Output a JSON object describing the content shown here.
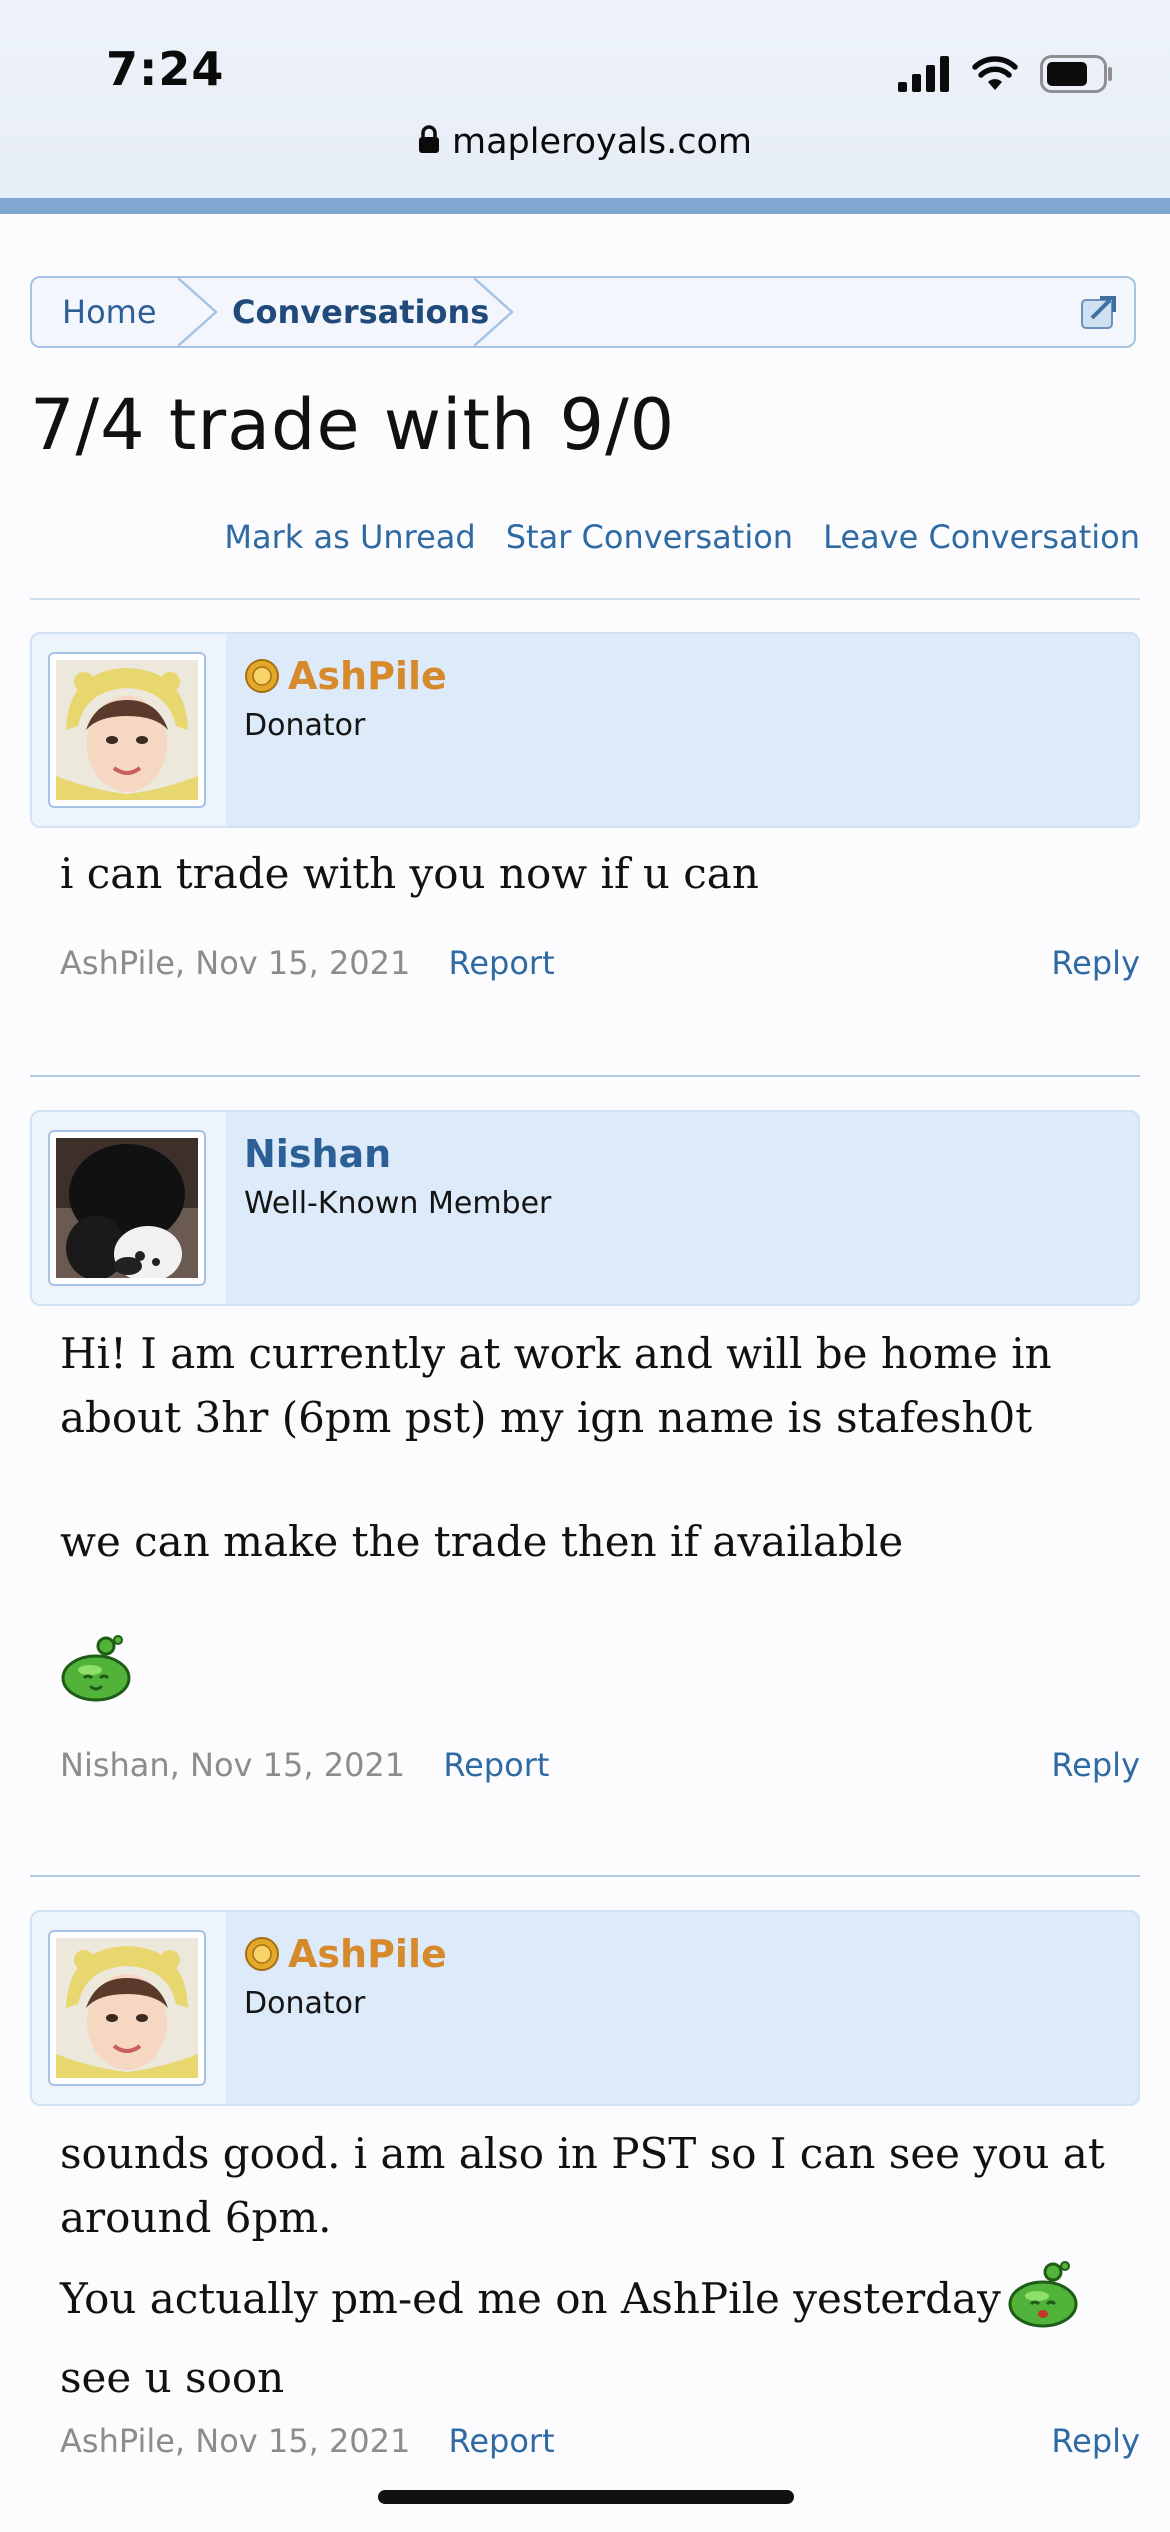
{
  "status_bar": {
    "time": "7:24"
  },
  "browser": {
    "url": "mapleroyals.com"
  },
  "breadcrumb": {
    "home": "Home",
    "conversations": "Conversations"
  },
  "page": {
    "title": "7/4 trade with 9/0"
  },
  "actions": {
    "mark_unread": "Mark as Unread",
    "star": "Star Conversation",
    "leave": "Leave Conversation"
  },
  "messages": [
    {
      "author": "AshPile",
      "user_title": "Donator",
      "body": [
        "i can trade with you now if u can"
      ],
      "meta_author": "AshPile",
      "date": "Nov 15, 2021",
      "report_label": "Report",
      "reply_label": "Reply"
    },
    {
      "author": "Nishan",
      "user_title": "Well-Known Member",
      "body": [
        "Hi! I am currently at work and will be home in about 3hr (6pm pst) my ign name is stafesh0t",
        "we can make the trade then if available"
      ],
      "meta_author": "Nishan",
      "date": "Nov 15, 2021",
      "report_label": "Report",
      "reply_label": "Reply"
    },
    {
      "author": "AshPile",
      "user_title": "Donator",
      "body": [
        "sounds good. i am also in PST so I can see you at around 6pm.",
        "You actually pm-ed me on AshPile yesterday",
        "see u soon"
      ],
      "meta_author": "AshPile",
      "date": "Nov 15, 2021",
      "report_label": "Report",
      "reply_label": "Reply"
    }
  ],
  "colors": {
    "link": "#2f6aa3",
    "donator": "#d68a2c",
    "member": "#2b5f96",
    "author_bg": "#dceaf9"
  },
  "icons": [
    "signal-icon",
    "wifi-icon",
    "battery-icon",
    "lock-icon",
    "popout-icon",
    "donator-badge-icon",
    "slime-emoji-icon"
  ]
}
